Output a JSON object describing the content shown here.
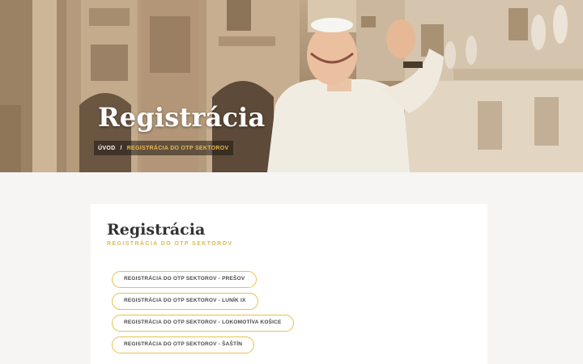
{
  "hero": {
    "title": "Registrácia",
    "breadcrumb": {
      "home": "ÚVOD",
      "separator": "/",
      "current": "REGISTRÁCIA DO OTP SEKTOROV"
    }
  },
  "section": {
    "title": "Registrácia",
    "subtitle": "REGISTRÁCIA DO OTP SEKTOROV",
    "links": [
      {
        "label": "REGISTRÁCIA DO OTP SEKTOROV - PREŠOV"
      },
      {
        "label": "REGISTRÁCIA DO OTP SEKTOROV - LUNÍK IX"
      },
      {
        "label": "REGISTRÁCIA DO OTP SEKTOROV - LOKOMOTÍVA KOŠICE"
      },
      {
        "label": "REGISTRÁCIA DO OTP SEKTOROV - ŠAŠTÍN"
      }
    ]
  },
  "colors": {
    "accent": "#e6c14f",
    "background": "#f6f5f3",
    "card": "#ffffff"
  }
}
